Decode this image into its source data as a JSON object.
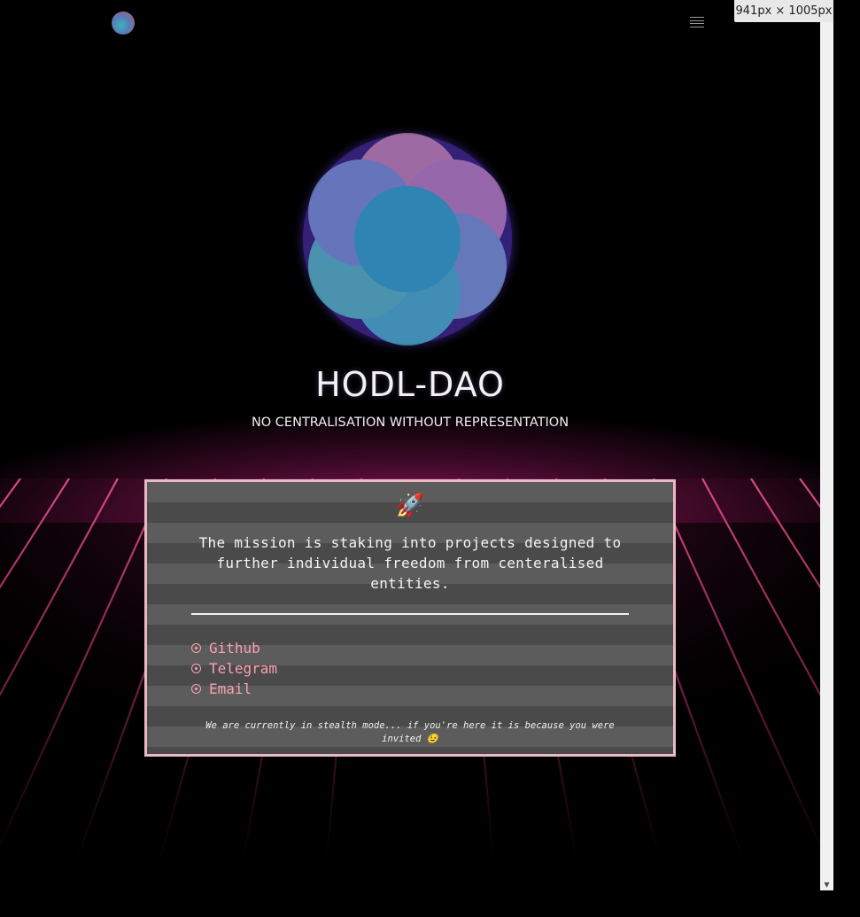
{
  "devtools": {
    "dimensions_label": "941px × 1005px"
  },
  "nav": {
    "logo_icon": "hodl-dao-orb-logo",
    "menu_icon": "hamburger-menu-icon"
  },
  "hero": {
    "logo_icon": "flower-of-life-orb-icon",
    "title": "HODL-DAO",
    "subtitle": "NO CENTRALISATION WITHOUT REPRESENTATION"
  },
  "card": {
    "icon": "🚀",
    "mission": "The mission is staking into projects designed to further individual freedom from centeralised entities.",
    "links": [
      {
        "label": "Github"
      },
      {
        "label": "Telegram"
      },
      {
        "label": "Email"
      }
    ],
    "note": "We are currently in stealth mode... if you're here it is because you were invited 😉"
  },
  "colors": {
    "background": "#000000",
    "card_border": "#e9b9c4",
    "link": "#ff9fb3",
    "glow": "#d2288c",
    "text": "#f2f2f2"
  }
}
